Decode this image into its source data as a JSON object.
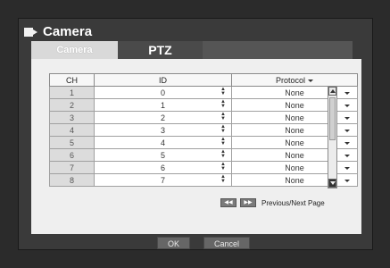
{
  "window": {
    "title": "Camera"
  },
  "tabs": [
    {
      "label": "Camera",
      "active": true
    },
    {
      "label": "PTZ",
      "active": false
    }
  ],
  "table": {
    "headers": {
      "ch": "CH",
      "id": "ID",
      "protocol": "Protocol"
    },
    "rows": [
      {
        "ch": "1",
        "id": "0",
        "protocol": "None"
      },
      {
        "ch": "2",
        "id": "1",
        "protocol": "None"
      },
      {
        "ch": "3",
        "id": "2",
        "protocol": "None"
      },
      {
        "ch": "4",
        "id": "3",
        "protocol": "None"
      },
      {
        "ch": "5",
        "id": "4",
        "protocol": "None"
      },
      {
        "ch": "6",
        "id": "5",
        "protocol": "None"
      },
      {
        "ch": "7",
        "id": "6",
        "protocol": "None"
      },
      {
        "ch": "8",
        "id": "7",
        "protocol": "None"
      }
    ]
  },
  "pager": {
    "label": "Previous/Next Page"
  },
  "footer": {
    "ok_label": "OK",
    "cancel_label": "Cancel"
  },
  "icons": {
    "title": "camera-icon",
    "prev": "rewind-icon",
    "next": "fast-forward-icon"
  },
  "colors": {
    "background": "#2b2b2b",
    "panel": "#efefef",
    "active_tab": "#d9d9d9"
  }
}
